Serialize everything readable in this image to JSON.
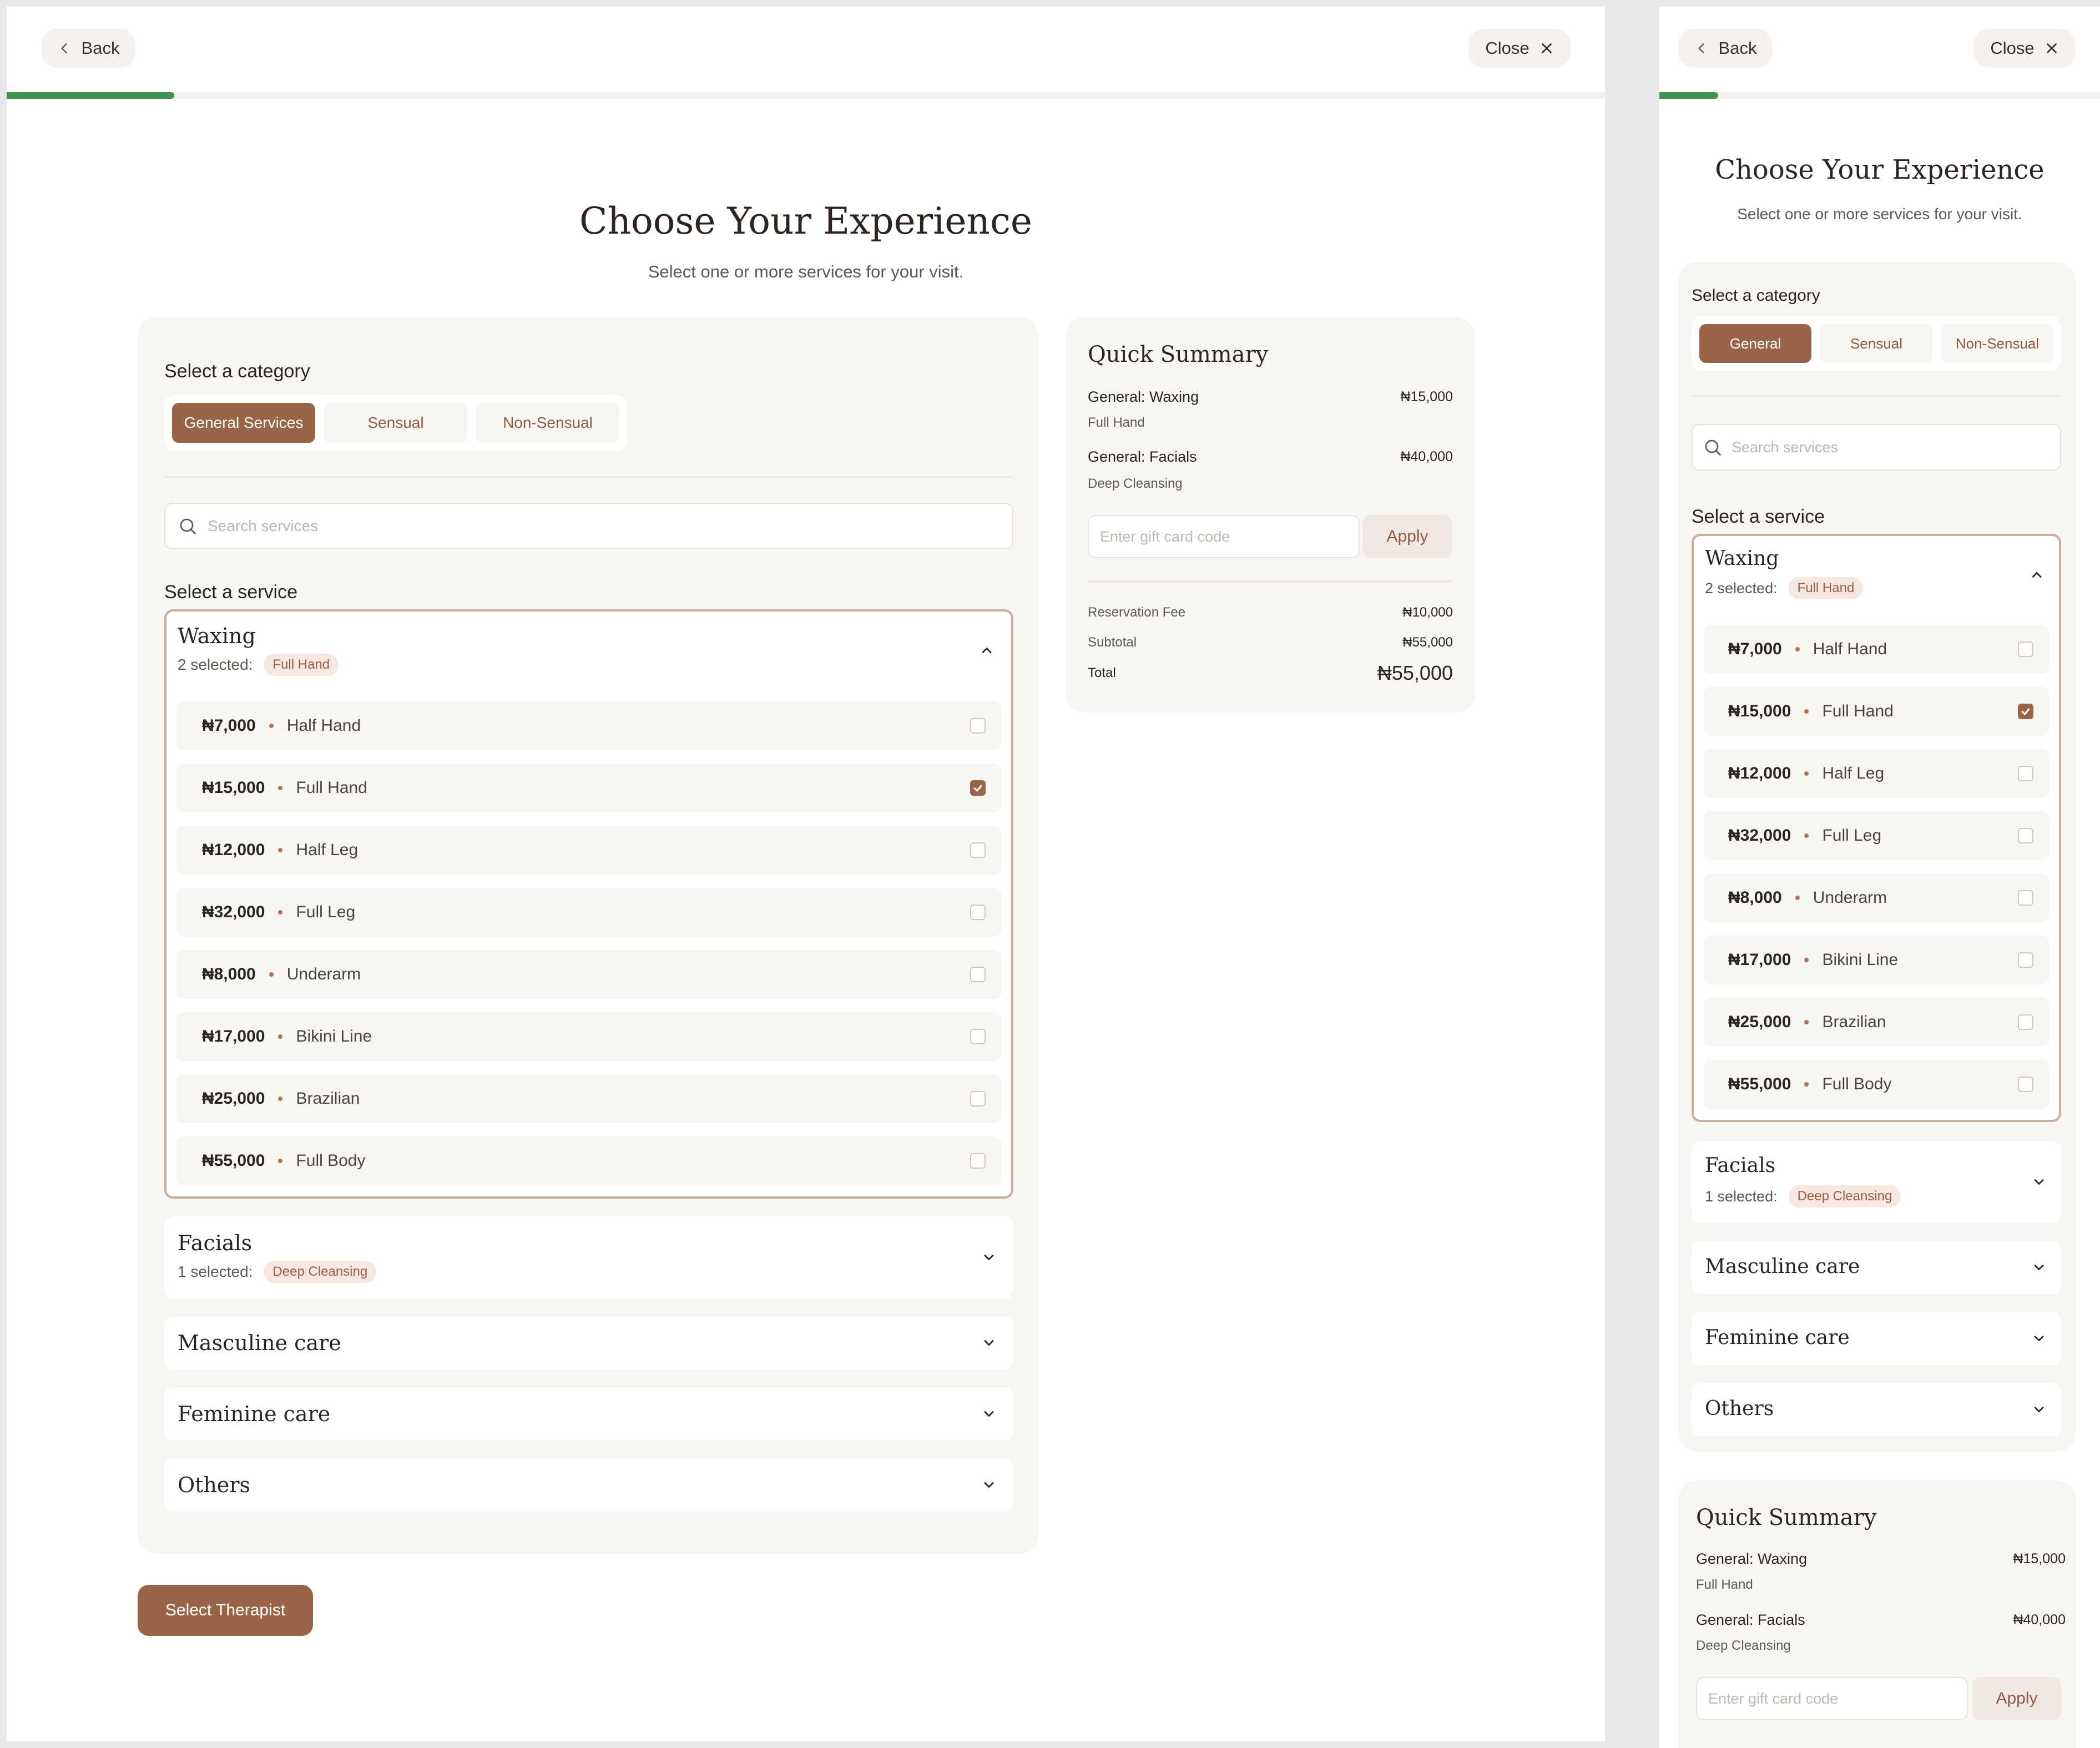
{
  "nav": {
    "back": "Back",
    "close": "Close",
    "progress_fraction": 0.105
  },
  "header": {
    "title": "Choose Your Experience",
    "subtitle": "Select one or more services for your visit."
  },
  "category": {
    "label": "Select a category",
    "desktop_options": [
      "General Services",
      "Sensual",
      "Non-Sensual"
    ],
    "mobile_options": [
      "General",
      "Sensual",
      "Non-Sensual"
    ],
    "active_index": 0
  },
  "search": {
    "placeholder": "Search services"
  },
  "service_label": "Select a service",
  "accordions": [
    {
      "title": "Waxing",
      "selected_text": "2 selected:",
      "tag": "Full Hand",
      "open": true
    },
    {
      "title": "Facials",
      "selected_text": "1 selected:",
      "tag": "Deep Cleansing",
      "open": false
    },
    {
      "title": "Masculine care",
      "open": false
    },
    {
      "title": "Feminine care",
      "open": false
    },
    {
      "title": "Others",
      "open": false
    }
  ],
  "waxing_services": [
    {
      "price": "₦7,000",
      "name": "Half Hand",
      "checked": false
    },
    {
      "price": "₦15,000",
      "name": "Full Hand",
      "checked": true
    },
    {
      "price": "₦12,000",
      "name": "Half Leg",
      "checked": false
    },
    {
      "price": "₦32,000",
      "name": "Full Leg",
      "checked": false
    },
    {
      "price": "₦8,000",
      "name": "Underarm",
      "checked": false
    },
    {
      "price": "₦17,000",
      "name": "Bikini Line",
      "checked": false
    },
    {
      "price": "₦25,000",
      "name": "Brazilian",
      "checked": false
    },
    {
      "price": "₦55,000",
      "name": "Full Body",
      "checked": false
    }
  ],
  "summary": {
    "title": "Quick Summary",
    "items": [
      {
        "name": "General: Waxing",
        "detail": "Full Hand",
        "price": "₦15,000"
      },
      {
        "name": "General: Facials",
        "detail": "Deep Cleansing",
        "price": "₦40,000"
      }
    ],
    "gift_placeholder": "Enter gift card code",
    "apply": "Apply",
    "reservation_label": "Reservation Fee",
    "reservation_value": "₦10,000",
    "subtotal_label": "Subtotal",
    "subtotal_value": "₦55,000",
    "total_label": "Total",
    "total_value": "₦55,000"
  },
  "cta": "Select Therapist",
  "colors": {
    "accent": "#9a6446",
    "progress": "#3f9450",
    "panel": "#f8f6f3"
  }
}
